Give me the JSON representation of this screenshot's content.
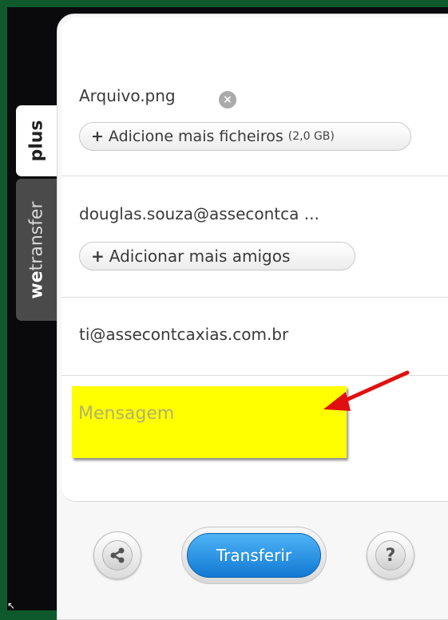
{
  "side_tabs": {
    "plus": "plus",
    "wetransfer_prefix": "we",
    "wetransfer_suffix": "transfer"
  },
  "upload": {
    "file_name": "Arquivo.png",
    "add_files_label": "Adicione mais ficheiros",
    "add_files_size": "(2,0 GB)"
  },
  "recipients": {
    "value": "douglas.souza@assecontca ...",
    "add_friends_label": "Adicionar mais amigos"
  },
  "sender": {
    "value": "ti@assecontcaxias.com.br"
  },
  "message": {
    "placeholder": "Mensagem"
  },
  "footer": {
    "transfer_label": "Transferir",
    "help_label": "?"
  },
  "colors": {
    "highlight": "#ffff00",
    "arrow": "#e01010",
    "primary_button": "#1a86de",
    "frame": "#0f5a2c"
  },
  "icons": {
    "remove": "x-circle-icon",
    "share": "share-icon",
    "help": "question-mark-icon"
  }
}
